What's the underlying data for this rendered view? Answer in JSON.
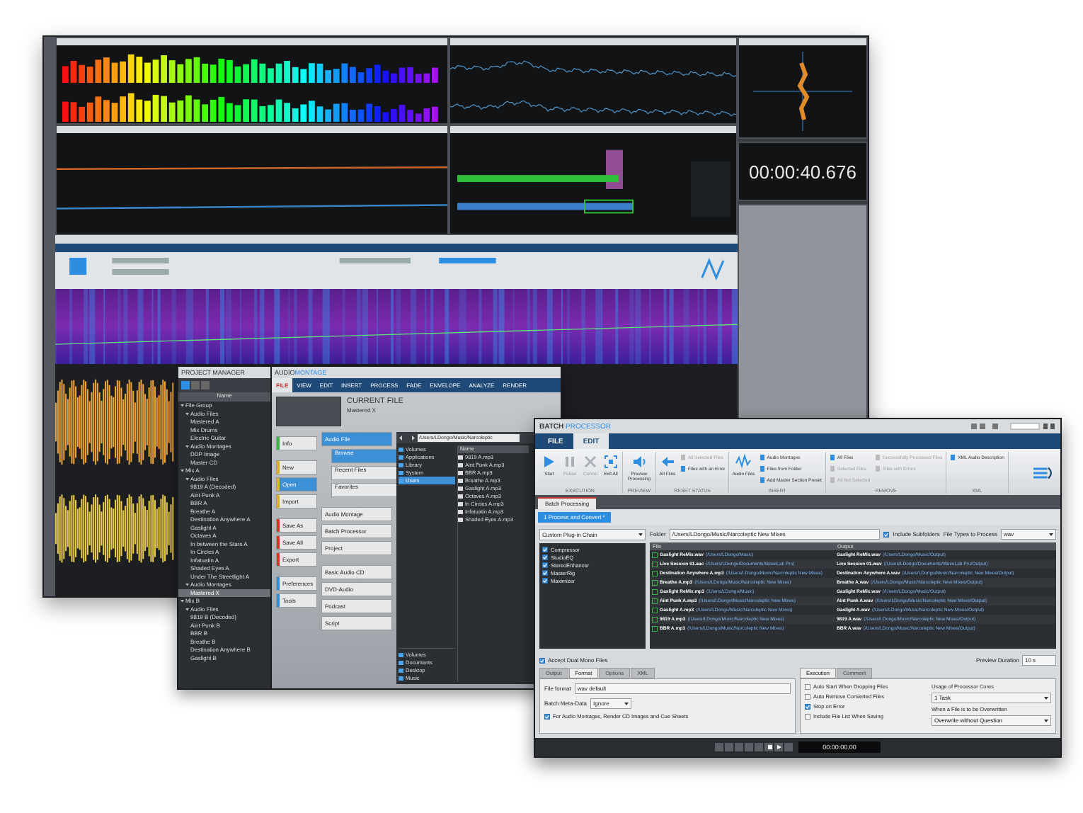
{
  "back_window": {
    "time_display": "00:00:40.676"
  },
  "project_manager": {
    "title": "PROJECT MANAGER",
    "column": "Name",
    "items": [
      {
        "label": "File Group",
        "selected": false,
        "children": [
          {
            "label": "Audio Files",
            "selected": false,
            "children": [
              {
                "label": "Mastered A",
                "selected": false
              },
              {
                "label": "Mix Drums",
                "selected": false
              },
              {
                "label": "Electric Guitar",
                "selected": false
              }
            ]
          },
          {
            "label": "Audio Montages",
            "selected": false,
            "children": [
              {
                "label": "DDP Image",
                "selected": false
              },
              {
                "label": "Master CD",
                "selected": false
              }
            ]
          }
        ]
      },
      {
        "label": "Mix A",
        "selected": false,
        "children": [
          {
            "label": "Audio Files",
            "selected": false,
            "children": [
              {
                "label": "9819 A (Decoded)",
                "selected": false
              },
              {
                "label": "Aint Punk A",
                "selected": false
              },
              {
                "label": "BBR A",
                "selected": false
              },
              {
                "label": "Breathe A",
                "selected": false
              },
              {
                "label": "Destination Anywhere A",
                "selected": false
              },
              {
                "label": "Gaslight A",
                "selected": false
              },
              {
                "label": "Octaves A",
                "selected": false
              },
              {
                "label": "In between the Stars A",
                "selected": false
              },
              {
                "label": "In Circles A",
                "selected": false
              },
              {
                "label": "Infatuatin A",
                "selected": false
              },
              {
                "label": "Shaded Eyes A",
                "selected": false
              },
              {
                "label": "Under The Streetlight A",
                "selected": false
              }
            ]
          },
          {
            "label": "Audio Montages",
            "selected": false,
            "children": [
              {
                "label": "Mastered X",
                "selected": true
              }
            ]
          }
        ]
      },
      {
        "label": "Mix B",
        "selected": false,
        "children": [
          {
            "label": "Audio Files",
            "selected": false,
            "children": [
              {
                "label": "9819 B (Decoded)",
                "selected": false
              },
              {
                "label": "Aint Punk B",
                "selected": false
              },
              {
                "label": "BBR B",
                "selected": false
              },
              {
                "label": "Breathe B",
                "selected": false
              },
              {
                "label": "Destination Anywhere B",
                "selected": false
              },
              {
                "label": "Gaslight B",
                "selected": false
              }
            ]
          }
        ]
      }
    ]
  },
  "montage_window": {
    "title_main": "AUDIO",
    "title_accent": "MONTAGE",
    "tabs": [
      {
        "label": "FILE",
        "selected": true
      },
      {
        "label": "VIEW",
        "selected": false
      },
      {
        "label": "EDIT",
        "selected": false
      },
      {
        "label": "INSERT",
        "selected": false
      },
      {
        "label": "PROCESS",
        "selected": false
      },
      {
        "label": "FADE",
        "selected": false
      },
      {
        "label": "ENVELOPE",
        "selected": false
      },
      {
        "label": "ANALYZE",
        "selected": false
      },
      {
        "label": "RENDER",
        "selected": false
      }
    ],
    "current_file_heading": "CURRENT FILE",
    "current_file": "Mastered X",
    "menu": [
      [
        {
          "label": "Info",
          "selected": false,
          "color": "#3cb44b"
        }
      ],
      [
        {
          "label": "New",
          "selected": false,
          "color": "#d9b22a"
        },
        {
          "label": "Open",
          "selected": true,
          "color": "#d9b22a"
        },
        {
          "label": "Import",
          "selected": false,
          "color": "#d9b22a"
        }
      ],
      [
        {
          "label": "Save As",
          "selected": false,
          "color": "#d8342c"
        },
        {
          "label": "Save All",
          "selected": false,
          "color": "#d8342c"
        },
        {
          "label": "Export",
          "selected": false,
          "color": "#d8342c"
        }
      ],
      [
        {
          "label": "Preferences",
          "selected": false,
          "color": "#2d8de0"
        },
        {
          "label": "Tools",
          "selected": false,
          "color": "#2d8de0"
        }
      ]
    ],
    "submenu": [
      [
        {
          "label": "Audio File",
          "kind": "header",
          "selected": true
        },
        {
          "label": "Browse",
          "kind": "sub",
          "selected": true
        },
        {
          "label": "Recent Files",
          "kind": "sub",
          "selected": false
        },
        {
          "label": "Favorites",
          "kind": "sub",
          "selected": false
        }
      ],
      [
        {
          "label": "Audio Montage",
          "kind": "item",
          "selected": false
        },
        {
          "label": "Batch Processor",
          "kind": "item",
          "selected": false
        },
        {
          "label": "Project",
          "kind": "item",
          "selected": false
        }
      ],
      [
        {
          "label": "Basic Audio CD",
          "kind": "item",
          "selected": false
        },
        {
          "label": "DVD-Audio",
          "kind": "item",
          "selected": false
        },
        {
          "label": "Podcast",
          "kind": "item",
          "selected": false
        },
        {
          "label": "Script",
          "kind": "item",
          "selected": false
        }
      ]
    ],
    "path": "/Users/LDongo/Music/Narcoleptic",
    "folders": [
      {
        "label": "Volumes",
        "selected": false
      },
      {
        "label": "Applications",
        "selected": false
      },
      {
        "label": "Library",
        "selected": false
      },
      {
        "label": "System",
        "selected": false
      },
      {
        "label": "Users",
        "selected": true
      }
    ],
    "places": [
      "Volumes",
      "Documents",
      "Desktop",
      "Music"
    ],
    "files_column": "Name",
    "files": [
      "9819 A.mp3",
      "Aint Punk A.mp3",
      "BBR A.mp3",
      "Breathe A.mp3",
      "Gaslight A.mp3",
      "Octaves A.mp3",
      "In Circles A.mp3",
      "Infatuatin A.mp3",
      "Shaded Eyes A.mp3"
    ]
  },
  "batch_window": {
    "title_main": "BATCH",
    "title_accent": "PROCESSOR",
    "tabs": [
      {
        "label": "FILE",
        "selected": false
      },
      {
        "label": "EDIT",
        "selected": true
      }
    ],
    "ribbon": [
      {
        "label": "EXECUTION",
        "items": [
          {
            "kind": "large",
            "label": "Start",
            "disabled": false
          },
          {
            "kind": "large",
            "label": "Pause",
            "disabled": true
          },
          {
            "kind": "large",
            "label": "Cancel",
            "disabled": true
          },
          {
            "kind": "large",
            "label": "Exit All",
            "disabled": false
          }
        ]
      },
      {
        "label": "PREVIEW",
        "items": [
          {
            "kind": "large",
            "label": "Preview Processing",
            "disabled": false
          }
        ]
      },
      {
        "label": "RESET STATUS",
        "items": [
          {
            "kind": "large",
            "label": "All Files",
            "disabled": false
          },
          {
            "kind": "small",
            "label": "All Selected Files",
            "disabled": true
          },
          {
            "kind": "small",
            "label": "Files with an Error",
            "disabled": false
          }
        ]
      },
      {
        "label": "INSERT",
        "items": [
          {
            "kind": "large",
            "label": "Audio Files",
            "disabled": false
          },
          {
            "kind": "small",
            "label": "Audio Montages",
            "disabled": false
          },
          {
            "kind": "small",
            "label": "Files from Folder",
            "disabled": false
          },
          {
            "kind": "small",
            "label": "Add Master Section Preset",
            "disabled": false
          }
        ]
      },
      {
        "label": "REMOVE",
        "items": [
          {
            "kind": "small",
            "label": "All Files",
            "disabled": false
          },
          {
            "kind": "small",
            "label": "Selected Files",
            "disabled": true
          },
          {
            "kind": "small",
            "label": "All Not Selected",
            "disabled": true
          },
          {
            "kind": "small",
            "label": "Successfully Processed Files",
            "disabled": true
          },
          {
            "kind": "small",
            "label": "Files with Errors",
            "disabled": true
          }
        ]
      },
      {
        "label": "XML",
        "items": [
          {
            "kind": "small",
            "label": "XML Audio Description",
            "disabled": false
          }
        ]
      }
    ],
    "document_tab": "Batch Processing",
    "process_tab": "1 Process and Convert *",
    "chain_select": "Custom Plug-in Chain",
    "plugins": [
      {
        "label": "Compressor",
        "checked": true
      },
      {
        "label": "StudioEQ",
        "checked": true
      },
      {
        "label": "StereoEnhancer",
        "checked": true
      },
      {
        "label": "MasterRig",
        "checked": true
      },
      {
        "label": "Maximizer",
        "checked": true
      }
    ],
    "folder_label": "Folder",
    "folder_path": "/Users/LDongo/Music/Narcoleptic New Mixes",
    "include_subfolders": {
      "label": "Include Subfolders",
      "checked": true
    },
    "file_types_label": "File Types to Process",
    "file_types": "wav",
    "table": {
      "columns": [
        "File",
        "Output"
      ],
      "rows": [
        {
          "file": "Gaslight ReMix.wav",
          "file_path": "(/Users/LDongo/Music)",
          "output": "Gaslight ReMix.wav",
          "output_path": "(/Users/LDongo/Music/Output)"
        },
        {
          "file": "Live Session 01.aac",
          "file_path": "(/Users/LDongo/Documents/WaveLab Pro)",
          "output": "Live Session 01.wav",
          "output_path": "(/Users/LDongo/Documents/WaveLab Pro/Output)"
        },
        {
          "file": "Destination Anywhere A.mp3",
          "file_path": "(/Users/LDongo/Music/Narcoleptic New Mixes)",
          "output": "Destination Anywhere A.wav",
          "output_path": "(/Users/LDongo/Music/Narcoleptic New Mixes/Output)"
        },
        {
          "file": "Breathe A.mp3",
          "file_path": "(/Users/LDongo/Music/Narcoleptic New Mixes)",
          "output": "Breathe A.wav",
          "output_path": "(/Users/LDongo/Music/Narcoleptic New Mixes/Output)"
        },
        {
          "file": "Gaslight ReMix.mp3",
          "file_path": "(/Users/LDongo/Music)",
          "output": "Gaslight ReMix.wav",
          "output_path": "(/Users/LDongo/Music/Output)"
        },
        {
          "file": "Aint Punk A.mp3",
          "file_path": "(/Users/LDongo/Music/Narcoleptic New Mixes)",
          "output": "Aint Punk A.wav",
          "output_path": "(/Users/LDongo/Music/Narcoleptic New Mixes/Output)"
        },
        {
          "file": "Gaslight A.mp3",
          "file_path": "(/Users/LDongo/Music/Narcoleptic New Mixes)",
          "output": "Gaslight A.wav",
          "output_path": "(/Users/LDongo/Music/Narcoleptic New Mixes/Output)"
        },
        {
          "file": "9819 A.mp3",
          "file_path": "(/Users/LDongo/Music/Narcoleptic New Mixes)",
          "output": "9819 A.wav",
          "output_path": "(/Users/LDongo/Music/Narcoleptic New Mixes/Output)"
        },
        {
          "file": "BBR A.mp3",
          "file_path": "(/Users/LDongo/Music/Narcoleptic New Mixes)",
          "output": "BBR A.wav",
          "output_path": "(/Users/LDongo/Music/Narcoleptic New Mixes/Output)"
        }
      ]
    },
    "accept_dual_mono": {
      "label": "Accept Dual Mono Files",
      "checked": true
    },
    "preview_duration_label": "Preview Duration",
    "preview_duration": "10 s",
    "left_tabs": [
      {
        "label": "Output",
        "selected": false
      },
      {
        "label": "Format",
        "selected": true
      },
      {
        "label": "Options",
        "selected": false
      },
      {
        "label": "XML",
        "selected": false
      }
    ],
    "file_format_label": "File format",
    "file_format": "wav default",
    "meta_label": "Batch Meta-Data",
    "meta_value": "Ignore",
    "render_cd": {
      "label": "For Audio Montages, Render CD Images and Cue Sheets",
      "checked": true
    },
    "right_tabs": [
      {
        "label": "Execution",
        "selected": true
      },
      {
        "label": "Comment",
        "selected": false
      }
    ],
    "options": [
      {
        "label": "Auto Start When Dropping Files",
        "checked": false
      },
      {
        "label": "Auto Remove Converted Files",
        "checked": false
      },
      {
        "label": "Stop on Error",
        "checked": true
      },
      {
        "label": "Include File List When Saving",
        "checked": false
      }
    ],
    "cores_label": "Usage of Processor Cores",
    "cores": "1 Task",
    "overwrite_label": "When a File is to be Overwritten",
    "overwrite": "Overwrite without Question",
    "transport_time": "00:00:00.00"
  }
}
